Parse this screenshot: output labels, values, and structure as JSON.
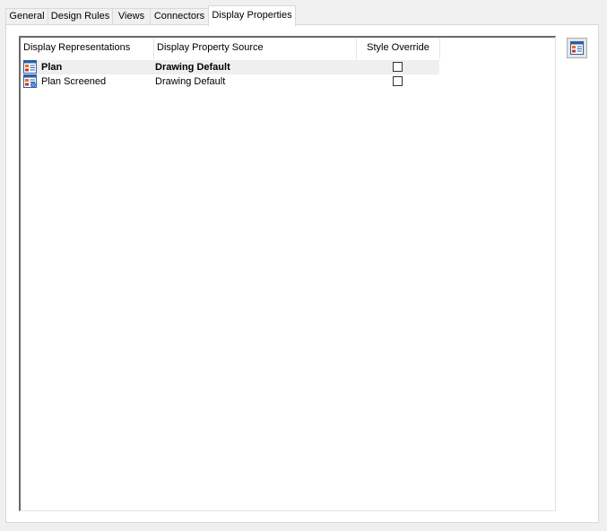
{
  "tabs": [
    {
      "label": "General"
    },
    {
      "label": "Design Rules"
    },
    {
      "label": "Views"
    },
    {
      "label": "Connectors"
    },
    {
      "label": "Display Properties",
      "active": true
    }
  ],
  "grid": {
    "columns": [
      "Display Representations",
      "Display Property Source",
      "Style Override"
    ],
    "rows": [
      {
        "name": "Plan",
        "source": "Drawing Default",
        "style_override": false,
        "bold": true,
        "selected": true,
        "icon": "display-rep-icon"
      },
      {
        "name": "Plan Screened",
        "source": "Drawing Default",
        "style_override": false,
        "bold": false,
        "selected": false,
        "icon": "display-rep-screened-icon"
      }
    ]
  },
  "side_button": {
    "icon": "edit-display-properties-icon"
  },
  "colors": {
    "icon_blue": "#2b5ea7",
    "icon_orange": "#e07020",
    "icon_red": "#c83232"
  }
}
